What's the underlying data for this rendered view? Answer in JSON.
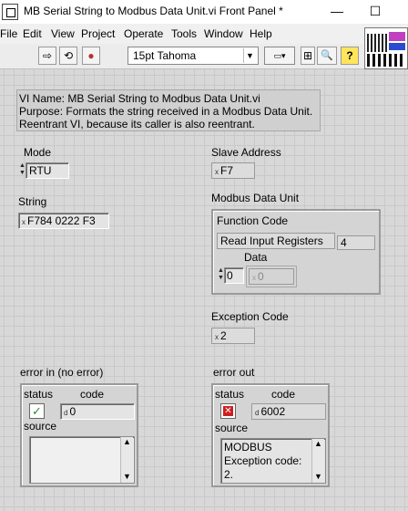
{
  "window": {
    "title": "MB Serial String to Modbus Data Unit.vi Front Panel *",
    "minimize_glyph": "—",
    "maximize_glyph": "☐"
  },
  "menu": [
    "File",
    "Edit",
    "View",
    "Project",
    "Operate",
    "Tools",
    "Window",
    "Help"
  ],
  "toolbar": {
    "font_value": "15pt Tahoma",
    "run_glyph": "⇨",
    "run_continuous_glyph": "⟲",
    "abort_glyph": "●",
    "search_glyph": "🔍",
    "help_glyph": "?"
  },
  "description": {
    "line1": "VI Name: MB Serial String to Modbus Data Unit.vi",
    "line2": "Purpose: Formats the string received in a Modbus Data Unit.",
    "line3": "Reentrant VI, because its caller is also reentrant."
  },
  "mode": {
    "label": "Mode",
    "value": "RTU"
  },
  "slave_address": {
    "label": "Slave Address",
    "radix": "x",
    "value": "F7"
  },
  "string": {
    "label": "String",
    "radix": "x",
    "value": "F784 0222 F3"
  },
  "modbus_data_unit": {
    "label": "Modbus Data Unit",
    "function_code_label": "Function Code",
    "function_code_value": "Read Input Registers",
    "function_code_number": "4",
    "data_label": "Data",
    "data_index": "0",
    "data_value": "0",
    "data_radix": "x"
  },
  "exception_code": {
    "label": "Exception Code",
    "radix": "x",
    "value": "2"
  },
  "error_in": {
    "label": "error in (no error)",
    "status_label": "status",
    "code_label": "code",
    "code_radix": "d",
    "code_value": "0",
    "source_label": "source",
    "source_text": ""
  },
  "error_out": {
    "label": "error out",
    "status_label": "status",
    "code_label": "code",
    "code_radix": "d",
    "code_value": "6002",
    "source_label": "source",
    "source_line1": "MODBUS",
    "source_line2": "Exception code:",
    "source_line3": "2."
  },
  "colors": {
    "status_ok": "#2e8b2e",
    "status_error": "#cc2020"
  }
}
